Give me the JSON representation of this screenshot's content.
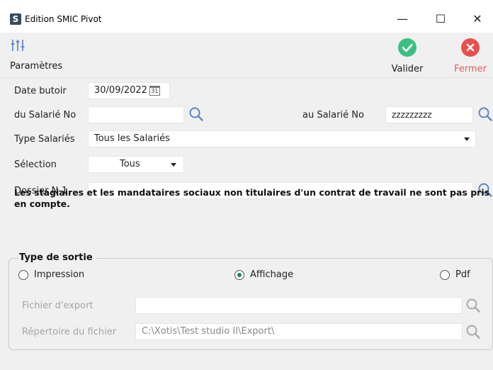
{
  "window": {
    "app_icon_letter": "S",
    "title": "Edition SMIC Pivot",
    "minimize": "—",
    "maximize": "☐",
    "close": "✕"
  },
  "toolbar": {
    "params_label": "Paramètres",
    "valider_label": "Valider",
    "fermer_label": "Fermer",
    "valider_color": "#3cbf7f",
    "fermer_color": "#e8504f",
    "fermer_text_color": "#e35b5b"
  },
  "form": {
    "date_butoir_label": "Date butoir",
    "date_butoir_value": "30/09/2022",
    "calendar_day": "31",
    "du_salarie_label": "du Salarié No",
    "du_salarie_value": "",
    "au_salarie_label": "au Salarié No",
    "au_salarie_value": "zzzzzzzzz",
    "type_salaries_label": "Type Salariés",
    "type_salaries_value": "Tous les Salariés",
    "selection_label": "Sélection",
    "selection_value": "Tous",
    "dossier_label": "Dossier N-1",
    "dossier_value": "",
    "note": "Les stagiaires et les mandataires sociaux non titulaires d'un contrat de travail ne sont pas pris en compte."
  },
  "output": {
    "group_title": "Type de sortie",
    "options": [
      {
        "label": "Impression",
        "checked": false
      },
      {
        "label": "Affichage",
        "checked": true
      },
      {
        "label": "Pdf",
        "checked": false
      }
    ],
    "fichier_export_label": "Fichier d'export",
    "fichier_export_value": "",
    "repertoire_label": "Répertoire du fichier",
    "repertoire_value": "C:\\Xotis\\Test studio II\\Export\\"
  }
}
